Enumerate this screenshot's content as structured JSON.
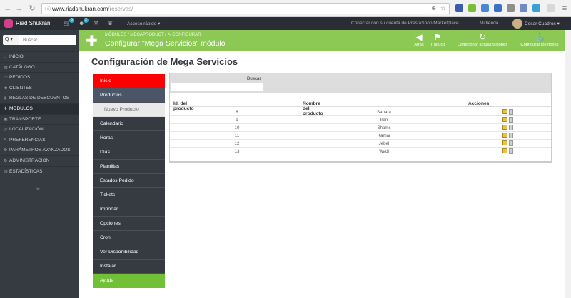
{
  "browser": {
    "url_domain": "www.riadshukran.com",
    "url_path": "/reservas/"
  },
  "header": {
    "shop_name": "Riad Shukran",
    "cart_badge": "5",
    "user_badge": "2",
    "quick_access": "Acceso rápido ▾",
    "connect_text": "Conectar con su cuenta de PrestaShop Marketplace",
    "my_store": "Mi tienda",
    "user_name": "Cesar Cuadros ▾"
  },
  "sidebar": {
    "search_button": "Q ▾",
    "search_placeholder": "Buscar",
    "items": [
      {
        "label": "INICIO",
        "icon": "⌂"
      },
      {
        "label": "CATÁLOGO",
        "icon": "▤"
      },
      {
        "label": "PEDIDOS",
        "icon": "▭"
      },
      {
        "label": "CLIENTES",
        "icon": "☻"
      },
      {
        "label": "REGLAS DE DESCUENTOS",
        "icon": "◈"
      },
      {
        "label": "MÓDULOS",
        "icon": "✚"
      },
      {
        "label": "TRANSPORTE",
        "icon": "▣"
      },
      {
        "label": "LOCALIZACIÓN",
        "icon": "◎"
      },
      {
        "label": "PREFERENCIAS",
        "icon": "✎"
      },
      {
        "label": "PARÁMETROS AVANZADOS",
        "icon": "⚙"
      },
      {
        "label": "ADMINISTRACIÓN",
        "icon": "⚙"
      },
      {
        "label": "ESTADÍSTICAS",
        "icon": "▥"
      }
    ]
  },
  "toolbar": {
    "breadcrumb": "MÓDULOS  /  MEGAPRODUCT  /  ✎ CONFIGURAR",
    "title": "Configurar \"Mega Servicios\" módulo",
    "buttons": [
      {
        "label": "Atrás",
        "icon": "◀"
      },
      {
        "label": "Traducir",
        "icon": "⚑"
      },
      {
        "label": "Comprobar actualizaciones",
        "icon": "↻"
      },
      {
        "label": "Configurar los hooks",
        "icon": "⚓"
      }
    ]
  },
  "page": {
    "title": "Configuración de Mega Servicios"
  },
  "left_menu": {
    "items": [
      "Inicio",
      "Productos",
      "Nuevo Producto",
      "Calendario",
      "Horas",
      "Días",
      "Plantillas",
      "Estados Pedido",
      "Tickets",
      "Importar",
      "Opciones",
      "Cron",
      "Ver Disponibilidad",
      "Instalar",
      "Ayuda"
    ]
  },
  "table": {
    "search_label": "Buscar",
    "columns": [
      "Id. del producto",
      "Nombre del producto",
      "Acciones"
    ],
    "rows": [
      {
        "id": "8",
        "name": "Sahara"
      },
      {
        "id": "9",
        "name": "Iran"
      },
      {
        "id": "10",
        "name": "Shams"
      },
      {
        "id": "11",
        "name": "Kamar"
      },
      {
        "id": "12",
        "name": "Jebel"
      },
      {
        "id": "13",
        "name": "Wadi"
      }
    ]
  },
  "colors": {
    "toolbar_green": "#8bc954",
    "sidebar_dark": "#363a41",
    "inicio_red": "#ff0000",
    "ayuda_green": "#72c035"
  }
}
